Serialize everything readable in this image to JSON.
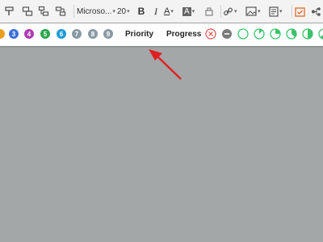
{
  "toolbar": {
    "font_name": "Microso...",
    "font_size": "20",
    "bold_label": "B",
    "italic_label": "I",
    "underline_label": "A",
    "highlight_label": "A"
  },
  "stickers": {
    "numbers": [
      "3",
      "4",
      "5",
      "6",
      "7",
      "8",
      "9"
    ],
    "number_colors": [
      "#3b6fd8",
      "#b03ab5",
      "#2aa64a",
      "#1d9bd6",
      "#8a9aa4",
      "#8a9aa4",
      "#8a9aa4"
    ],
    "priority_label": "Priority",
    "progress_label": "Progress",
    "progress_levels": [
      0,
      0.125,
      0.25,
      0.375,
      0.5,
      0.625
    ],
    "accent_green": "#3cc36c",
    "cancel_color": "#e05050",
    "minus_color": "#7a7a7a"
  },
  "annotation": {
    "arrow_color": "#e02020"
  }
}
